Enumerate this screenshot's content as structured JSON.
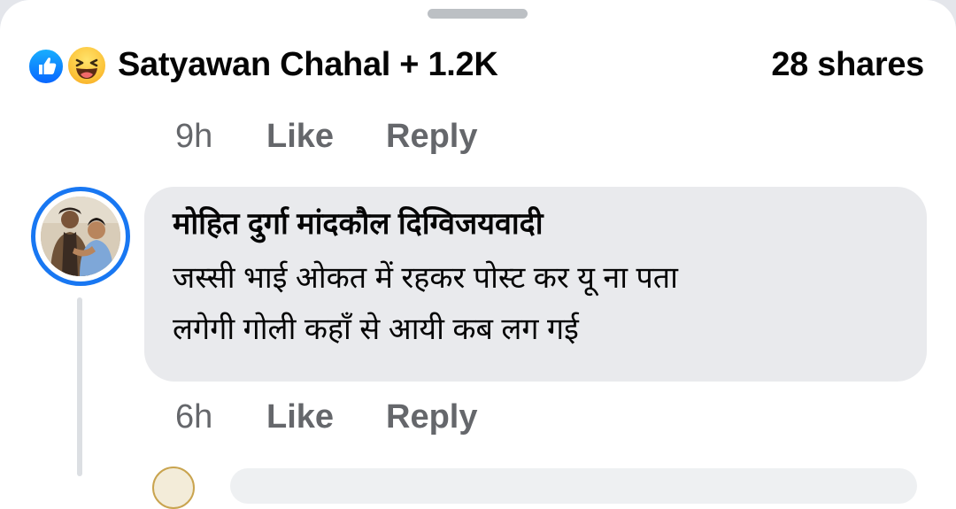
{
  "reactions": {
    "icons": [
      "like-icon",
      "haha-icon"
    ],
    "names": "Satyawan Chahal + 1.2K",
    "shares": "28 shares"
  },
  "parent_actions": {
    "time": "9h",
    "like": "Like",
    "reply": "Reply"
  },
  "comment": {
    "author": "मोहित दुर्गा मांदकौल दिग्विजयवादी",
    "text_line1": "जस्सी भाई ओकत में रहकर पोस्ट कर यू ना पता",
    "text_line2": "लगेगी गोली कहाँ से आयी कब लग गई",
    "time": "6h",
    "like": "Like",
    "reply": "Reply"
  },
  "colors": {
    "accent": "#1877f2",
    "bubble": "#e9eaed",
    "meta": "#65676b"
  }
}
